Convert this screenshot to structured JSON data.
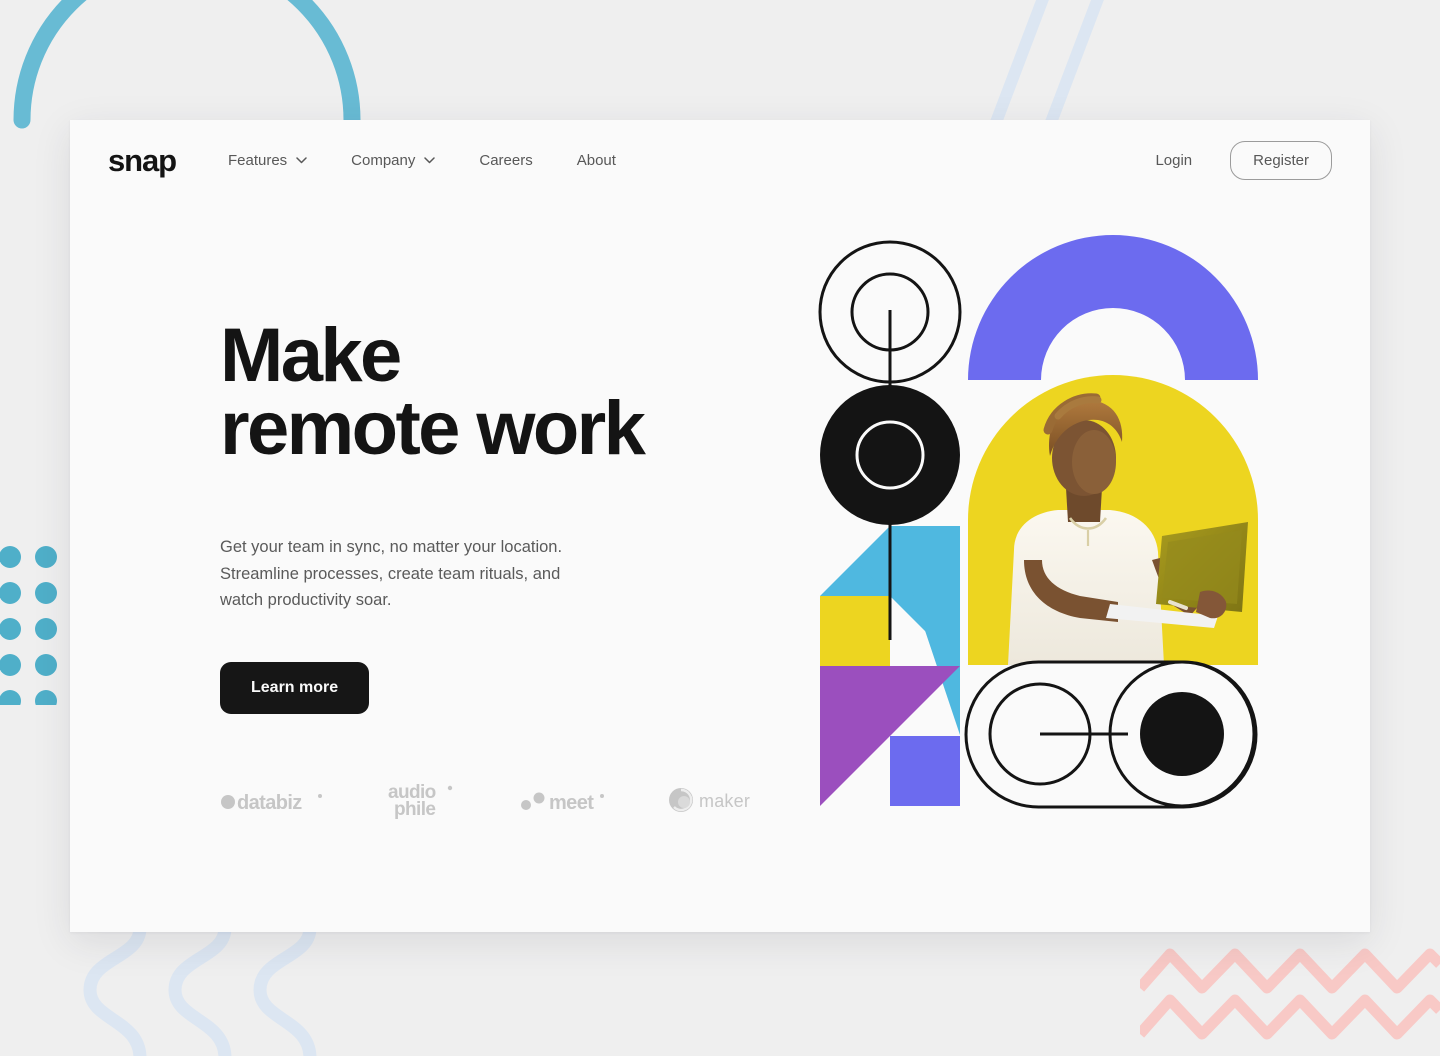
{
  "page": {
    "background_color": "#efefef",
    "card_color": "#fafafa"
  },
  "header": {
    "logo": "snap",
    "nav": [
      {
        "label": "Features",
        "has_dropdown": true,
        "icon": "chevron-down-icon"
      },
      {
        "label": "Company",
        "has_dropdown": true,
        "icon": "chevron-down-icon"
      },
      {
        "label": "Careers",
        "has_dropdown": false,
        "icon": ""
      },
      {
        "label": "About",
        "has_dropdown": false,
        "icon": ""
      }
    ],
    "login_label": "Login",
    "register_label": "Register"
  },
  "hero": {
    "headline": "Make\nremote work",
    "subcopy": "Get your team in sync, no matter your location.\nStreamline processes, create team rituals, and\nwatch productivity soar.",
    "cta_label": "Learn more"
  },
  "clients": [
    {
      "name": "databiz",
      "label": "databiz",
      "icon": "dot-mark-icon"
    },
    {
      "name": "audiophile",
      "label": "audio phile",
      "icon": "dot-mark-icon"
    },
    {
      "name": "meet",
      "label": "meet",
      "icon": "two-dots-icon"
    },
    {
      "name": "maker",
      "label": "maker",
      "icon": "circle-swirl-icon"
    }
  ],
  "colors": {
    "ink": "#141414",
    "muted_text": "#5a5a5a",
    "periwinkle": "#6C6BEF",
    "yellow": "#EDD520",
    "cyan": "#4FB8E0",
    "purple": "#9B4FBE",
    "pale_blue": "#DCE6F2",
    "pink": "#F8C9C6",
    "client_gray": "#C6C6C6"
  },
  "hero_art": {
    "description": "Geometric composition with a photo of a person using a laptop inside a yellow arch",
    "shapes": [
      "outline-circle-with-inner-ring",
      "black-donut",
      "periwinkle-arch",
      "yellow-arch-photo",
      "cyan-triangles",
      "yellow-square",
      "purple-triangle",
      "periwinkle-square",
      "outline-pill-toggle"
    ]
  },
  "decorations": [
    {
      "name": "arc-topleft",
      "color": "#68BBD4"
    },
    {
      "name": "stripes-topright",
      "color": "#DCE6F2"
    },
    {
      "name": "dots-left",
      "color": "#4FAFC9"
    },
    {
      "name": "waves-bottomleft",
      "color": "#DCE6F2"
    },
    {
      "name": "zigzag-bottomright",
      "color": "#F8C9C6"
    }
  ]
}
